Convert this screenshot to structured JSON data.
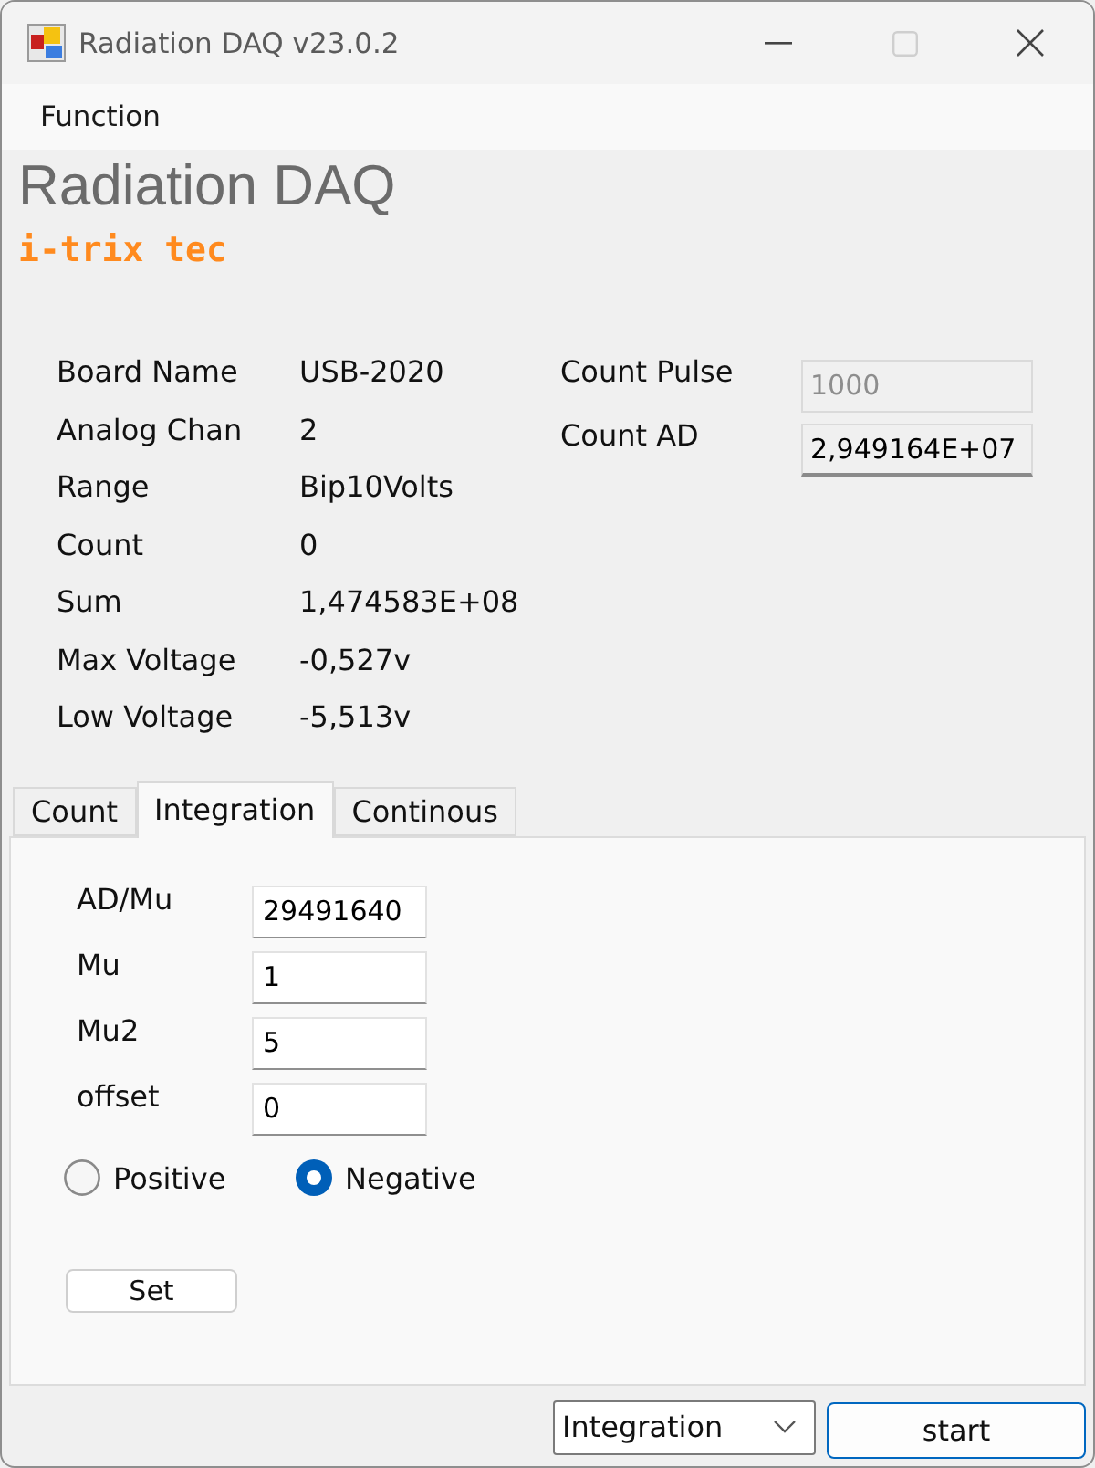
{
  "window": {
    "title": "Radiation DAQ v23.0.2",
    "maximize_disabled": true
  },
  "menu": [
    {
      "label": "Function"
    }
  ],
  "header": {
    "title": "Radiation DAQ",
    "subtitle": "i-trix tec"
  },
  "info": [
    {
      "label": "Board Name",
      "value": "USB-2020"
    },
    {
      "label": "Analog Chan",
      "value": "2"
    },
    {
      "label": "Range",
      "value": "Bip10Volts"
    },
    {
      "label": "Count",
      "value": "0"
    },
    {
      "label": "Sum",
      "value": "1,474583E+08"
    },
    {
      "label": "Max Voltage",
      "value": "-0,527v"
    },
    {
      "label": "Low Voltage",
      "value": "-5,513v"
    }
  ],
  "counters": [
    {
      "label": "Count Pulse",
      "value": "1000",
      "disabled": true
    },
    {
      "label": "Count AD",
      "value": "2,949164E+07",
      "disabled": false
    }
  ],
  "tabs": [
    {
      "label": "Count",
      "selected": false
    },
    {
      "label": "Integration",
      "selected": true
    },
    {
      "label": "Continous",
      "selected": false
    }
  ],
  "params": [
    {
      "label": "AD/Mu",
      "value": "29491640"
    },
    {
      "label": "Mu",
      "value": "1"
    },
    {
      "label": "Mu2",
      "value": "5"
    },
    {
      "label": "offset",
      "value": "0"
    }
  ],
  "polarity": [
    {
      "label": "Positive",
      "selected": false
    },
    {
      "label": "Negative",
      "selected": true
    }
  ],
  "set_button": "Set",
  "mode_select": {
    "value": "Integration"
  },
  "start_button": "start"
}
